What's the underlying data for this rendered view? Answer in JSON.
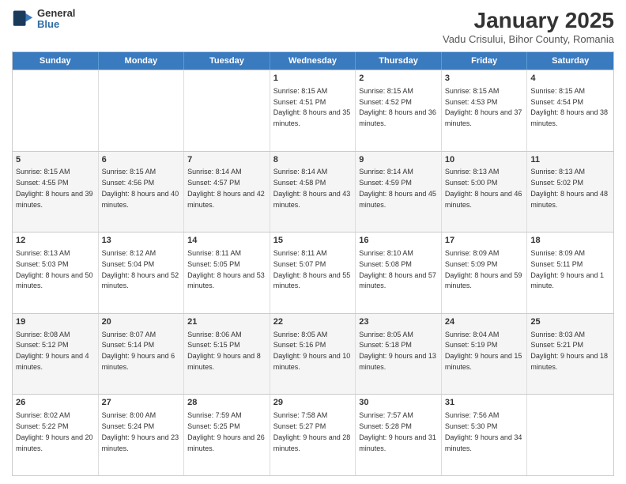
{
  "header": {
    "logo": {
      "line1": "General",
      "line2": "Blue"
    },
    "title": "January 2025",
    "subtitle": "Vadu Crisului, Bihor County, Romania"
  },
  "weekdays": [
    "Sunday",
    "Monday",
    "Tuesday",
    "Wednesday",
    "Thursday",
    "Friday",
    "Saturday"
  ],
  "weeks": [
    [
      {
        "day": "",
        "sunrise": "",
        "sunset": "",
        "daylight": ""
      },
      {
        "day": "",
        "sunrise": "",
        "sunset": "",
        "daylight": ""
      },
      {
        "day": "",
        "sunrise": "",
        "sunset": "",
        "daylight": ""
      },
      {
        "day": "1",
        "sunrise": "Sunrise: 8:15 AM",
        "sunset": "Sunset: 4:51 PM",
        "daylight": "Daylight: 8 hours and 35 minutes."
      },
      {
        "day": "2",
        "sunrise": "Sunrise: 8:15 AM",
        "sunset": "Sunset: 4:52 PM",
        "daylight": "Daylight: 8 hours and 36 minutes."
      },
      {
        "day": "3",
        "sunrise": "Sunrise: 8:15 AM",
        "sunset": "Sunset: 4:53 PM",
        "daylight": "Daylight: 8 hours and 37 minutes."
      },
      {
        "day": "4",
        "sunrise": "Sunrise: 8:15 AM",
        "sunset": "Sunset: 4:54 PM",
        "daylight": "Daylight: 8 hours and 38 minutes."
      }
    ],
    [
      {
        "day": "5",
        "sunrise": "Sunrise: 8:15 AM",
        "sunset": "Sunset: 4:55 PM",
        "daylight": "Daylight: 8 hours and 39 minutes."
      },
      {
        "day": "6",
        "sunrise": "Sunrise: 8:15 AM",
        "sunset": "Sunset: 4:56 PM",
        "daylight": "Daylight: 8 hours and 40 minutes."
      },
      {
        "day": "7",
        "sunrise": "Sunrise: 8:14 AM",
        "sunset": "Sunset: 4:57 PM",
        "daylight": "Daylight: 8 hours and 42 minutes."
      },
      {
        "day": "8",
        "sunrise": "Sunrise: 8:14 AM",
        "sunset": "Sunset: 4:58 PM",
        "daylight": "Daylight: 8 hours and 43 minutes."
      },
      {
        "day": "9",
        "sunrise": "Sunrise: 8:14 AM",
        "sunset": "Sunset: 4:59 PM",
        "daylight": "Daylight: 8 hours and 45 minutes."
      },
      {
        "day": "10",
        "sunrise": "Sunrise: 8:13 AM",
        "sunset": "Sunset: 5:00 PM",
        "daylight": "Daylight: 8 hours and 46 minutes."
      },
      {
        "day": "11",
        "sunrise": "Sunrise: 8:13 AM",
        "sunset": "Sunset: 5:02 PM",
        "daylight": "Daylight: 8 hours and 48 minutes."
      }
    ],
    [
      {
        "day": "12",
        "sunrise": "Sunrise: 8:13 AM",
        "sunset": "Sunset: 5:03 PM",
        "daylight": "Daylight: 8 hours and 50 minutes."
      },
      {
        "day": "13",
        "sunrise": "Sunrise: 8:12 AM",
        "sunset": "Sunset: 5:04 PM",
        "daylight": "Daylight: 8 hours and 52 minutes."
      },
      {
        "day": "14",
        "sunrise": "Sunrise: 8:11 AM",
        "sunset": "Sunset: 5:05 PM",
        "daylight": "Daylight: 8 hours and 53 minutes."
      },
      {
        "day": "15",
        "sunrise": "Sunrise: 8:11 AM",
        "sunset": "Sunset: 5:07 PM",
        "daylight": "Daylight: 8 hours and 55 minutes."
      },
      {
        "day": "16",
        "sunrise": "Sunrise: 8:10 AM",
        "sunset": "Sunset: 5:08 PM",
        "daylight": "Daylight: 8 hours and 57 minutes."
      },
      {
        "day": "17",
        "sunrise": "Sunrise: 8:09 AM",
        "sunset": "Sunset: 5:09 PM",
        "daylight": "Daylight: 8 hours and 59 minutes."
      },
      {
        "day": "18",
        "sunrise": "Sunrise: 8:09 AM",
        "sunset": "Sunset: 5:11 PM",
        "daylight": "Daylight: 9 hours and 1 minute."
      }
    ],
    [
      {
        "day": "19",
        "sunrise": "Sunrise: 8:08 AM",
        "sunset": "Sunset: 5:12 PM",
        "daylight": "Daylight: 9 hours and 4 minutes."
      },
      {
        "day": "20",
        "sunrise": "Sunrise: 8:07 AM",
        "sunset": "Sunset: 5:14 PM",
        "daylight": "Daylight: 9 hours and 6 minutes."
      },
      {
        "day": "21",
        "sunrise": "Sunrise: 8:06 AM",
        "sunset": "Sunset: 5:15 PM",
        "daylight": "Daylight: 9 hours and 8 minutes."
      },
      {
        "day": "22",
        "sunrise": "Sunrise: 8:05 AM",
        "sunset": "Sunset: 5:16 PM",
        "daylight": "Daylight: 9 hours and 10 minutes."
      },
      {
        "day": "23",
        "sunrise": "Sunrise: 8:05 AM",
        "sunset": "Sunset: 5:18 PM",
        "daylight": "Daylight: 9 hours and 13 minutes."
      },
      {
        "day": "24",
        "sunrise": "Sunrise: 8:04 AM",
        "sunset": "Sunset: 5:19 PM",
        "daylight": "Daylight: 9 hours and 15 minutes."
      },
      {
        "day": "25",
        "sunrise": "Sunrise: 8:03 AM",
        "sunset": "Sunset: 5:21 PM",
        "daylight": "Daylight: 9 hours and 18 minutes."
      }
    ],
    [
      {
        "day": "26",
        "sunrise": "Sunrise: 8:02 AM",
        "sunset": "Sunset: 5:22 PM",
        "daylight": "Daylight: 9 hours and 20 minutes."
      },
      {
        "day": "27",
        "sunrise": "Sunrise: 8:00 AM",
        "sunset": "Sunset: 5:24 PM",
        "daylight": "Daylight: 9 hours and 23 minutes."
      },
      {
        "day": "28",
        "sunrise": "Sunrise: 7:59 AM",
        "sunset": "Sunset: 5:25 PM",
        "daylight": "Daylight: 9 hours and 26 minutes."
      },
      {
        "day": "29",
        "sunrise": "Sunrise: 7:58 AM",
        "sunset": "Sunset: 5:27 PM",
        "daylight": "Daylight: 9 hours and 28 minutes."
      },
      {
        "day": "30",
        "sunrise": "Sunrise: 7:57 AM",
        "sunset": "Sunset: 5:28 PM",
        "daylight": "Daylight: 9 hours and 31 minutes."
      },
      {
        "day": "31",
        "sunrise": "Sunrise: 7:56 AM",
        "sunset": "Sunset: 5:30 PM",
        "daylight": "Daylight: 9 hours and 34 minutes."
      },
      {
        "day": "",
        "sunrise": "",
        "sunset": "",
        "daylight": ""
      }
    ]
  ]
}
